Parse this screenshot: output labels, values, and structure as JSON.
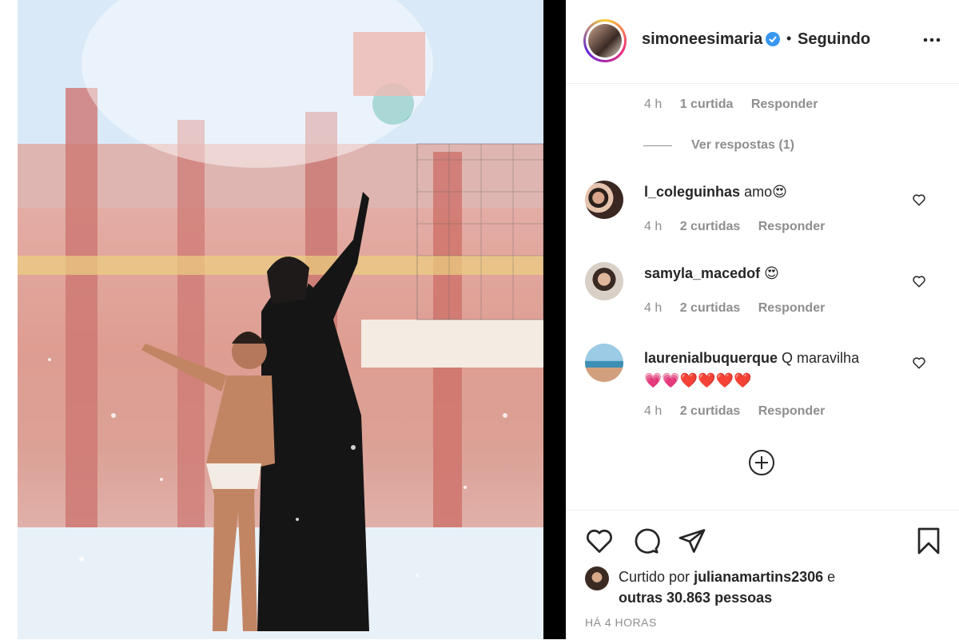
{
  "post": {
    "username": "simoneesimaria",
    "follow_status": "Seguindo",
    "separator": "•"
  },
  "comments": {
    "prev_meta": {
      "time": "4 h",
      "likes": "1 curtida",
      "reply": "Responder"
    },
    "view_replies": "Ver respostas (1)",
    "items": [
      {
        "username": "l_coleguinhas",
        "text": "amo",
        "emoji": "😍",
        "time": "4 h",
        "likes": "2 curtidas",
        "reply": "Responder"
      },
      {
        "username": "samyla_macedof",
        "text": "",
        "emoji": "😍",
        "time": "4 h",
        "likes": "2 curtidas",
        "reply": "Responder"
      },
      {
        "username": "laurenialbuquerque",
        "text": "Q maravilha",
        "emoji": "💗💗❤️❤️❤️❤️",
        "time": "4 h",
        "likes": "2 curtidas",
        "reply": "Responder"
      }
    ]
  },
  "likes": {
    "prefix": "Curtido por",
    "user": "juliana­martins2306",
    "connector": "e",
    "others": "outras 30.863 pessoas"
  },
  "timestamp": "HÁ 4 HORAS",
  "colors": {
    "verified": "#3897f0",
    "muted": "#8e8e8e",
    "text": "#262626"
  },
  "icons": [
    "more-icon",
    "verified-icon",
    "heart-icon",
    "comment-icon",
    "share-icon",
    "bookmark-icon",
    "plus-circle-icon"
  ]
}
